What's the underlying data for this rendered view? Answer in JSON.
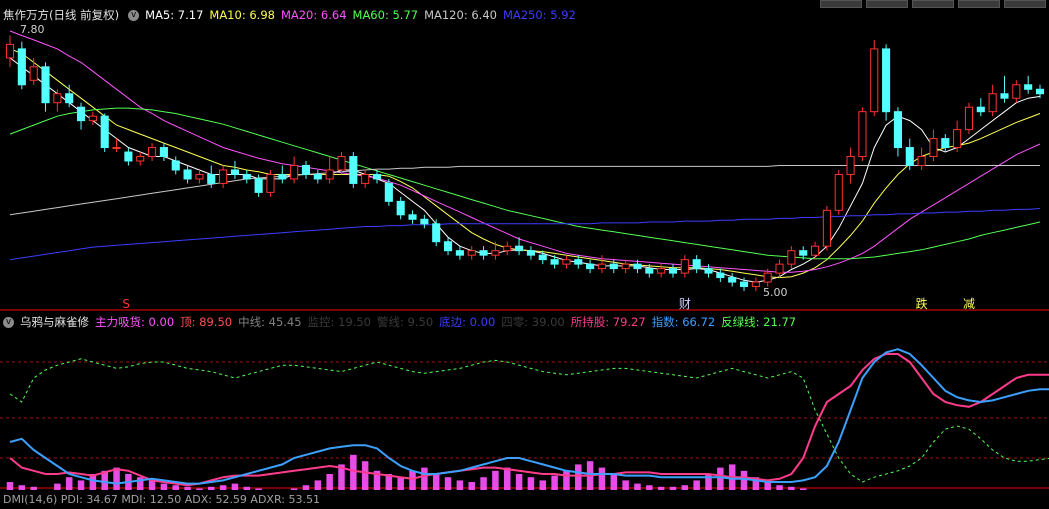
{
  "colors": {
    "up": "#ff3232",
    "down": "#54ffff",
    "ma5": "#ffffff",
    "ma10": "#ffff54",
    "ma20": "#ff54ff",
    "ma60": "#54ff54",
    "ma120": "#c8c8c8",
    "ma250": "#3c3cff",
    "grid": "#7a0000",
    "top_line": "#ff3c8c",
    "index_line": "#3ca0ff",
    "green_line": "#54ff54",
    "bars": "#ff54ff"
  },
  "main_header": {
    "title": "焦作万方(日线 前复权)",
    "ma5_label": "MA5: 7.17",
    "ma10_label": "MA10: 6.98",
    "ma20_label": "MA20: 6.64",
    "ma60_label": "MA60: 5.77",
    "ma120_label": "MA120: 6.40",
    "ma250_label": "MA250: 5.92"
  },
  "ind_header": {
    "name": "乌鸦与麻雀修",
    "accum": "主力吸货: 0.00",
    "top": "顶: 89.50",
    "mid": "中线: 45.45",
    "hidden1": "监控: 19.50",
    "hidden2": "警线: 9.50",
    "bottom": "底边: 0.00",
    "hidden3": "四零: 39.00",
    "holding": "所持股: 79.27",
    "index": "指数: 66.72",
    "rebound": "反绿线: 21.77"
  },
  "bottom_header": {
    "text": "DMI(14,6)  PDI: 34.67  MDI: 12.50  ADX: 52.59  ADXR: 53.51"
  },
  "chart_data": {
    "type": "candlestick",
    "price_labels": {
      "high": "7.80",
      "low": "5.00"
    },
    "markers": [
      {
        "text": "S",
        "color": "#ff3232",
        "index": 10
      },
      {
        "text": "财",
        "color": "#d0d0ff",
        "index": 57
      },
      {
        "text": "跌",
        "color": "#ffff54",
        "index": 77
      },
      {
        "text": "减",
        "color": "#ffff54",
        "index": 81
      }
    ],
    "candles": [
      [
        7.6,
        7.75,
        7.85,
        7.5
      ],
      [
        7.7,
        7.3,
        7.78,
        7.25
      ],
      [
        7.35,
        7.5,
        7.6,
        7.3
      ],
      [
        7.5,
        7.1,
        7.55,
        7.0
      ],
      [
        7.1,
        7.2,
        7.25,
        7.0
      ],
      [
        7.2,
        7.1,
        7.3,
        7.05
      ],
      [
        7.05,
        6.9,
        7.1,
        6.8
      ],
      [
        6.9,
        6.95,
        7.0,
        6.85
      ],
      [
        6.95,
        6.6,
        6.98,
        6.55
      ],
      [
        6.6,
        6.6,
        6.7,
        6.55
      ],
      [
        6.55,
        6.45,
        6.6,
        6.4
      ],
      [
        6.45,
        6.5,
        6.55,
        6.4
      ],
      [
        6.5,
        6.6,
        6.65,
        6.45
      ],
      [
        6.6,
        6.5,
        6.65,
        6.45
      ],
      [
        6.45,
        6.35,
        6.5,
        6.3
      ],
      [
        6.35,
        6.25,
        6.4,
        6.2
      ],
      [
        6.25,
        6.3,
        6.35,
        6.2
      ],
      [
        6.3,
        6.2,
        6.4,
        6.15
      ],
      [
        6.2,
        6.35,
        6.4,
        6.15
      ],
      [
        6.35,
        6.3,
        6.45,
        6.25
      ],
      [
        6.3,
        6.25,
        6.35,
        6.2
      ],
      [
        6.25,
        6.1,
        6.3,
        6.05
      ],
      [
        6.1,
        6.3,
        6.35,
        6.05
      ],
      [
        6.3,
        6.25,
        6.4,
        6.2
      ],
      [
        6.25,
        6.4,
        6.5,
        6.2
      ],
      [
        6.4,
        6.3,
        6.45,
        6.25
      ],
      [
        6.3,
        6.25,
        6.35,
        6.2
      ],
      [
        6.25,
        6.35,
        6.5,
        6.2
      ],
      [
        6.35,
        6.5,
        6.55,
        6.3
      ],
      [
        6.5,
        6.2,
        6.55,
        6.15
      ],
      [
        6.2,
        6.3,
        6.35,
        6.15
      ],
      [
        6.3,
        6.25,
        6.35,
        6.2
      ],
      [
        6.2,
        6.0,
        6.25,
        5.95
      ],
      [
        6.0,
        5.85,
        6.05,
        5.8
      ],
      [
        5.85,
        5.8,
        5.9,
        5.75
      ],
      [
        5.8,
        5.75,
        5.85,
        5.7
      ],
      [
        5.75,
        5.55,
        5.8,
        5.5
      ],
      [
        5.55,
        5.45,
        5.6,
        5.4
      ],
      [
        5.45,
        5.4,
        5.5,
        5.35
      ],
      [
        5.4,
        5.45,
        5.5,
        5.35
      ],
      [
        5.45,
        5.4,
        5.5,
        5.35
      ],
      [
        5.4,
        5.45,
        5.55,
        5.35
      ],
      [
        5.45,
        5.5,
        5.55,
        5.4
      ],
      [
        5.5,
        5.45,
        5.6,
        5.4
      ],
      [
        5.45,
        5.4,
        5.5,
        5.35
      ],
      [
        5.4,
        5.35,
        5.45,
        5.3
      ],
      [
        5.35,
        5.3,
        5.4,
        5.25
      ],
      [
        5.3,
        5.35,
        5.4,
        5.25
      ],
      [
        5.35,
        5.3,
        5.4,
        5.25
      ],
      [
        5.3,
        5.25,
        5.35,
        5.2
      ],
      [
        5.25,
        5.3,
        5.4,
        5.2
      ],
      [
        5.3,
        5.25,
        5.35,
        5.2
      ],
      [
        5.25,
        5.3,
        5.35,
        5.2
      ],
      [
        5.3,
        5.25,
        5.35,
        5.2
      ],
      [
        5.25,
        5.2,
        5.3,
        5.15
      ],
      [
        5.2,
        5.25,
        5.3,
        5.15
      ],
      [
        5.25,
        5.2,
        5.3,
        5.15
      ],
      [
        5.2,
        5.35,
        5.4,
        5.15
      ],
      [
        5.35,
        5.25,
        5.4,
        5.2
      ],
      [
        5.25,
        5.2,
        5.3,
        5.15
      ],
      [
        5.2,
        5.15,
        5.25,
        5.1
      ],
      [
        5.15,
        5.1,
        5.2,
        5.05
      ],
      [
        5.1,
        5.05,
        5.15,
        5.0
      ],
      [
        5.05,
        5.1,
        5.15,
        5.0
      ],
      [
        5.1,
        5.2,
        5.25,
        5.05
      ],
      [
        5.2,
        5.3,
        5.35,
        5.15
      ],
      [
        5.3,
        5.45,
        5.5,
        5.25
      ],
      [
        5.45,
        5.4,
        5.5,
        5.35
      ],
      [
        5.4,
        5.5,
        5.55,
        5.35
      ],
      [
        5.5,
        5.9,
        5.95,
        5.45
      ],
      [
        5.9,
        6.3,
        6.35,
        5.85
      ],
      [
        6.3,
        6.5,
        6.6,
        6.2
      ],
      [
        6.5,
        7.0,
        7.05,
        6.45
      ],
      [
        7.0,
        7.7,
        7.8,
        6.95
      ],
      [
        7.7,
        7.0,
        7.75,
        6.9
      ],
      [
        7.0,
        6.6,
        7.05,
        6.5
      ],
      [
        6.6,
        6.4,
        6.7,
        6.35
      ],
      [
        6.4,
        6.5,
        6.6,
        6.35
      ],
      [
        6.5,
        6.7,
        6.8,
        6.45
      ],
      [
        6.7,
        6.6,
        6.75,
        6.55
      ],
      [
        6.6,
        6.8,
        6.9,
        6.55
      ],
      [
        6.8,
        7.05,
        7.1,
        6.75
      ],
      [
        7.05,
        7.0,
        7.15,
        6.95
      ],
      [
        7.0,
        7.2,
        7.3,
        6.95
      ],
      [
        7.2,
        7.15,
        7.4,
        7.1
      ],
      [
        7.15,
        7.3,
        7.35,
        7.1
      ],
      [
        7.3,
        7.25,
        7.4,
        7.2
      ],
      [
        7.25,
        7.2,
        7.3,
        7.15
      ]
    ],
    "ma_lines": {
      "ma5": [
        7.6,
        7.5,
        7.4,
        7.3,
        7.2,
        7.1,
        7.0,
        6.9,
        6.8,
        6.7,
        6.6,
        6.55,
        6.5,
        6.5,
        6.45,
        6.4,
        6.35,
        6.3,
        6.3,
        6.3,
        6.3,
        6.25,
        6.25,
        6.25,
        6.3,
        6.3,
        6.3,
        6.3,
        6.35,
        6.35,
        6.3,
        6.25,
        6.2,
        6.1,
        6.0,
        5.9,
        5.75,
        5.6,
        5.5,
        5.45,
        5.42,
        5.42,
        5.45,
        5.46,
        5.45,
        5.42,
        5.38,
        5.34,
        5.32,
        5.3,
        5.28,
        5.28,
        5.28,
        5.28,
        5.26,
        5.24,
        5.24,
        5.24,
        5.25,
        5.24,
        5.2,
        5.16,
        5.12,
        5.1,
        5.12,
        5.16,
        5.24,
        5.3,
        5.38,
        5.5,
        5.7,
        5.95,
        6.2,
        6.6,
        6.85,
        6.95,
        6.9,
        6.8,
        6.6,
        6.55,
        6.6,
        6.7,
        6.8,
        6.9,
        7.0,
        7.1,
        7.15,
        7.17
      ],
      "ma10": [
        7.7,
        7.65,
        7.55,
        7.45,
        7.35,
        7.25,
        7.15,
        7.05,
        6.95,
        6.85,
        6.8,
        6.75,
        6.7,
        6.65,
        6.6,
        6.55,
        6.5,
        6.45,
        6.4,
        6.38,
        6.35,
        6.33,
        6.3,
        6.3,
        6.3,
        6.3,
        6.3,
        6.3,
        6.3,
        6.3,
        6.3,
        6.3,
        6.28,
        6.22,
        6.15,
        6.05,
        5.95,
        5.85,
        5.75,
        5.65,
        5.58,
        5.52,
        5.48,
        5.46,
        5.45,
        5.44,
        5.42,
        5.4,
        5.38,
        5.36,
        5.34,
        5.32,
        5.3,
        5.29,
        5.28,
        5.27,
        5.26,
        5.26,
        5.26,
        5.25,
        5.24,
        5.22,
        5.2,
        5.18,
        5.16,
        5.15,
        5.16,
        5.2,
        5.26,
        5.35,
        5.48,
        5.62,
        5.78,
        5.98,
        6.15,
        6.3,
        6.42,
        6.5,
        6.55,
        6.6,
        6.62,
        6.65,
        6.7,
        6.76,
        6.82,
        6.88,
        6.93,
        6.98
      ],
      "ma20": [
        7.9,
        7.85,
        7.8,
        7.75,
        7.7,
        7.62,
        7.55,
        7.45,
        7.35,
        7.25,
        7.15,
        7.05,
        6.98,
        6.9,
        6.84,
        6.78,
        6.72,
        6.66,
        6.6,
        6.56,
        6.52,
        6.48,
        6.45,
        6.42,
        6.4,
        6.38,
        6.36,
        6.34,
        6.32,
        6.3,
        6.28,
        6.26,
        6.22,
        6.18,
        6.12,
        6.06,
        6.0,
        5.94,
        5.88,
        5.82,
        5.76,
        5.7,
        5.64,
        5.58,
        5.54,
        5.5,
        5.46,
        5.42,
        5.4,
        5.38,
        5.36,
        5.35,
        5.34,
        5.33,
        5.32,
        5.31,
        5.3,
        5.29,
        5.28,
        5.27,
        5.26,
        5.25,
        5.24,
        5.23,
        5.22,
        5.21,
        5.21,
        5.22,
        5.24,
        5.27,
        5.31,
        5.36,
        5.42,
        5.5,
        5.6,
        5.7,
        5.8,
        5.88,
        5.96,
        6.04,
        6.12,
        6.2,
        6.28,
        6.36,
        6.44,
        6.52,
        6.58,
        6.64
      ],
      "ma60": [
        6.75,
        6.8,
        6.85,
        6.9,
        6.95,
        6.98,
        7.0,
        7.02,
        7.03,
        7.04,
        7.04,
        7.03,
        7.02,
        7.0,
        6.98,
        6.95,
        6.92,
        6.89,
        6.86,
        6.82,
        6.78,
        6.74,
        6.7,
        6.66,
        6.62,
        6.58,
        6.54,
        6.5,
        6.46,
        6.42,
        6.38,
        6.34,
        6.3,
        6.26,
        6.22,
        6.18,
        6.14,
        6.1,
        6.06,
        6.02,
        5.98,
        5.94,
        5.9,
        5.87,
        5.84,
        5.81,
        5.78,
        5.75,
        5.72,
        5.7,
        5.68,
        5.66,
        5.64,
        5.62,
        5.6,
        5.58,
        5.56,
        5.54,
        5.52,
        5.5,
        5.48,
        5.46,
        5.44,
        5.42,
        5.4,
        5.39,
        5.38,
        5.37,
        5.36,
        5.36,
        5.36,
        5.36,
        5.37,
        5.38,
        5.4,
        5.42,
        5.44,
        5.46,
        5.49,
        5.52,
        5.55,
        5.58,
        5.62,
        5.65,
        5.68,
        5.71,
        5.74,
        5.77
      ],
      "ma120": [
        5.85,
        5.87,
        5.89,
        5.91,
        5.93,
        5.95,
        5.97,
        5.99,
        6.01,
        6.03,
        6.05,
        6.07,
        6.09,
        6.11,
        6.13,
        6.15,
        6.17,
        6.19,
        6.21,
        6.23,
        6.25,
        6.26,
        6.27,
        6.28,
        6.29,
        6.3,
        6.31,
        6.32,
        6.33,
        6.34,
        6.35,
        6.36,
        6.36,
        6.37,
        6.37,
        6.38,
        6.38,
        6.38,
        6.39,
        6.39,
        6.39,
        6.39,
        6.39,
        6.39,
        6.39,
        6.39,
        6.39,
        6.39,
        6.39,
        6.39,
        6.39,
        6.39,
        6.39,
        6.39,
        6.39,
        6.39,
        6.39,
        6.39,
        6.39,
        6.39,
        6.39,
        6.39,
        6.39,
        6.39,
        6.39,
        6.4,
        6.4,
        6.4,
        6.4,
        6.4,
        6.4,
        6.4,
        6.4,
        6.4,
        6.4,
        6.4,
        6.4,
        6.4,
        6.4,
        6.4,
        6.4,
        6.4,
        6.4,
        6.4,
        6.4,
        6.4,
        6.4,
        6.4
      ],
      "ma250": [
        5.35,
        5.37,
        5.39,
        5.41,
        5.43,
        5.45,
        5.47,
        5.49,
        5.5,
        5.51,
        5.52,
        5.53,
        5.54,
        5.55,
        5.56,
        5.57,
        5.58,
        5.59,
        5.6,
        5.61,
        5.62,
        5.63,
        5.64,
        5.65,
        5.66,
        5.67,
        5.68,
        5.69,
        5.7,
        5.71,
        5.72,
        5.72,
        5.73,
        5.73,
        5.74,
        5.74,
        5.74,
        5.75,
        5.75,
        5.75,
        5.75,
        5.75,
        5.75,
        5.75,
        5.75,
        5.75,
        5.75,
        5.75,
        5.75,
        5.75,
        5.76,
        5.76,
        5.76,
        5.76,
        5.77,
        5.77,
        5.77,
        5.78,
        5.78,
        5.78,
        5.79,
        5.79,
        5.8,
        5.8,
        5.8,
        5.81,
        5.81,
        5.82,
        5.82,
        5.83,
        5.83,
        5.84,
        5.84,
        5.85,
        5.85,
        5.86,
        5.86,
        5.87,
        5.87,
        5.88,
        5.88,
        5.89,
        5.89,
        5.9,
        5.9,
        5.91,
        5.91,
        5.92
      ]
    },
    "indicator": {
      "top_line": [
        20,
        14,
        12,
        10,
        10,
        11,
        10,
        9,
        11,
        13,
        12,
        9,
        6,
        5,
        4,
        3,
        4,
        6,
        8,
        9,
        9,
        9,
        10,
        11,
        12,
        13,
        14,
        15,
        14,
        12,
        11,
        10,
        9,
        8,
        7,
        9,
        10,
        11,
        12,
        13,
        14,
        14,
        13,
        12,
        11,
        10,
        10,
        9,
        9,
        9,
        10,
        10,
        11,
        11,
        11,
        10,
        10,
        10,
        10,
        10,
        9,
        8,
        8,
        7,
        6,
        7,
        10,
        20,
        40,
        55,
        60,
        65,
        75,
        82,
        85,
        85,
        80,
        70,
        60,
        55,
        53,
        52,
        55,
        60,
        65,
        70,
        72,
        72,
        72
      ],
      "index_line": [
        30,
        32,
        25,
        20,
        15,
        10,
        8,
        6,
        5,
        4,
        5,
        6,
        7,
        6,
        5,
        4,
        4,
        5,
        6,
        8,
        10,
        12,
        14,
        16,
        20,
        22,
        24,
        26,
        27,
        28,
        28,
        26,
        20,
        15,
        12,
        10,
        10,
        11,
        12,
        14,
        16,
        18,
        20,
        20,
        18,
        16,
        14,
        12,
        11,
        10,
        10,
        10,
        9,
        9,
        9,
        8,
        8,
        8,
        8,
        8,
        8,
        7,
        7,
        6,
        5,
        5,
        5,
        6,
        8,
        15,
        30,
        50,
        70,
        80,
        86,
        88,
        85,
        78,
        70,
        62,
        58,
        56,
        55,
        56,
        58,
        60,
        62,
        63,
        63
      ],
      "green_line": [
        60,
        55,
        70,
        75,
        78,
        80,
        82,
        80,
        78,
        76,
        77,
        79,
        80,
        80,
        78,
        76,
        75,
        74,
        72,
        70,
        72,
        74,
        76,
        78,
        78,
        77,
        76,
        75,
        74,
        76,
        78,
        80,
        78,
        76,
        74,
        73,
        74,
        75,
        76,
        78,
        80,
        81,
        80,
        78,
        76,
        74,
        73,
        72,
        73,
        74,
        75,
        76,
        76,
        75,
        74,
        73,
        72,
        71,
        70,
        72,
        74,
        76,
        74,
        72,
        70,
        72,
        74,
        70,
        50,
        35,
        20,
        10,
        5,
        8,
        10,
        12,
        15,
        20,
        30,
        38,
        40,
        38,
        32,
        25,
        20,
        18,
        18,
        19,
        20
      ],
      "bars": [
        5,
        3,
        2,
        0,
        4,
        8,
        6,
        10,
        12,
        14,
        10,
        8,
        6,
        4,
        3,
        2,
        1,
        2,
        3,
        4,
        2,
        1,
        0,
        0,
        1,
        3,
        6,
        10,
        16,
        22,
        18,
        12,
        10,
        8,
        12,
        14,
        10,
        8,
        6,
        5,
        8,
        12,
        14,
        10,
        8,
        6,
        9,
        12,
        16,
        18,
        14,
        10,
        6,
        4,
        3,
        2,
        2,
        3,
        6,
        10,
        14,
        16,
        12,
        8,
        5,
        3,
        2,
        1,
        0,
        0,
        0,
        0,
        0,
        0,
        0,
        0,
        0,
        0,
        0,
        0,
        0,
        0,
        0,
        0,
        0,
        0,
        0,
        0,
        0
      ],
      "ref_lines": {
        "upper": 80,
        "mid": 45,
        "lower": 20
      }
    }
  }
}
